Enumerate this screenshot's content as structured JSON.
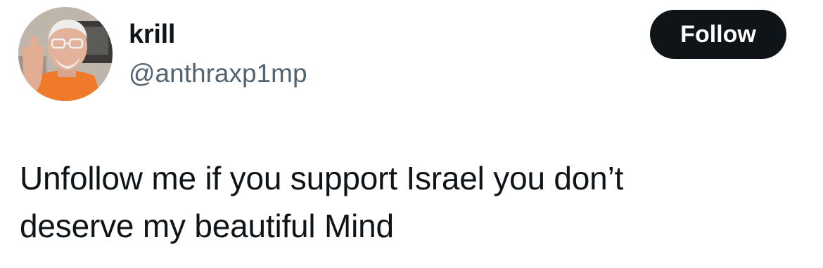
{
  "author": {
    "display_name": "krill",
    "handle": "@anthraxp1mp",
    "avatar_icon": "profile-photo-avatar"
  },
  "follow_button": {
    "label": "Follow"
  },
  "tweet": {
    "lines": [
      "Unfollow me if you support Israel you don’t",
      "deserve my beautiful Mind"
    ]
  },
  "colors": {
    "text_primary": "#0f1419",
    "text_secondary": "#536471",
    "button_bg": "#0f1419",
    "button_text": "#ffffff",
    "background": "#ffffff"
  }
}
